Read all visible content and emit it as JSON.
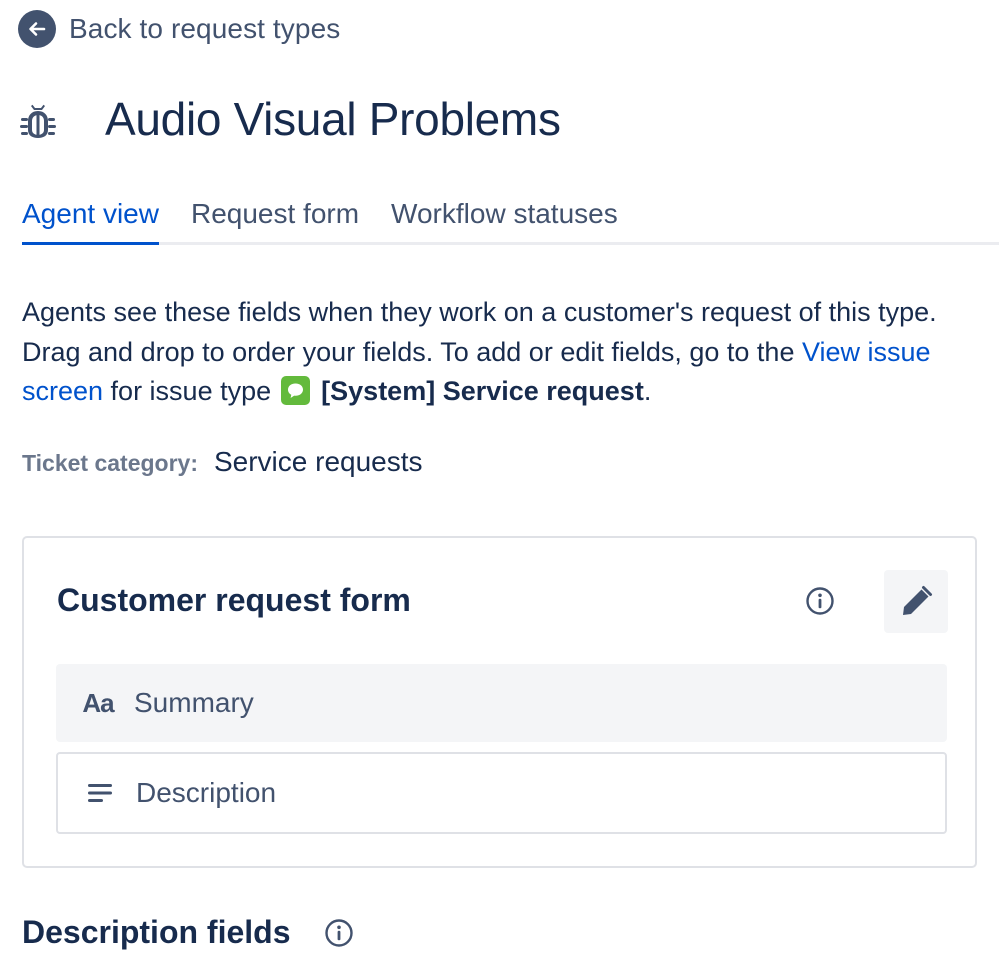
{
  "back_link": {
    "label": "Back to request types",
    "icon": "arrow-left-icon"
  },
  "header": {
    "title": "Audio Visual Problems",
    "icon": "bug-icon"
  },
  "tabs": [
    {
      "label": "Agent view",
      "active": true
    },
    {
      "label": "Request form",
      "active": false
    },
    {
      "label": "Workflow statuses",
      "active": false
    }
  ],
  "intro": {
    "text_before": "Agents see these fields when they work on a customer's request of this type. Drag and drop to order your fields. To add or edit fields, go to the ",
    "link_label": "View issue screen",
    "text_middle": " for issue type ",
    "issue_type_icon": "service-request-icon",
    "issue_type": "[System] Service request",
    "text_after": "."
  },
  "ticket_category": {
    "label": "Ticket category:",
    "value": "Service requests"
  },
  "customer_request_form": {
    "title": "Customer request form",
    "info_icon": "info-icon",
    "edit_icon": "pencil-icon",
    "fields": [
      {
        "label": "Summary",
        "icon": "text-icon",
        "icon_text": "Aa"
      },
      {
        "label": "Description",
        "icon": "paragraph-icon"
      }
    ]
  },
  "description_fields": {
    "title": "Description fields",
    "info_icon": "info-icon"
  },
  "colors": {
    "primary_text": "#172b4d",
    "secondary_text": "#42526e",
    "link": "#0052cc",
    "issue_type_green": "#63ba3c",
    "subtle_background": "#f4f5f7",
    "border": "#dfe1e6"
  }
}
